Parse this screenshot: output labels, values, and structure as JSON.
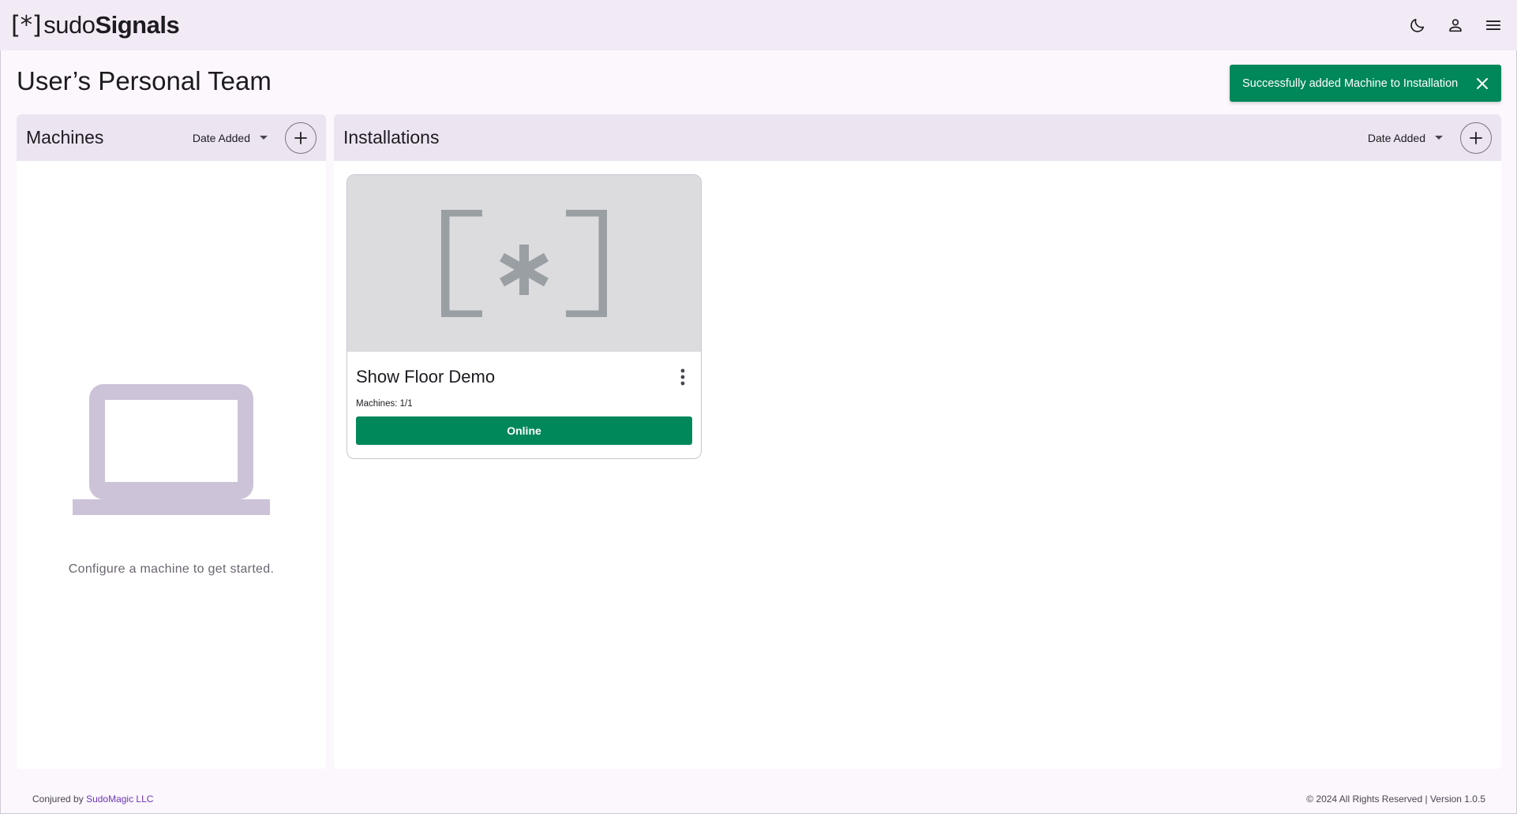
{
  "app": {
    "logo_bracket_open": "[",
    "logo_star": "*",
    "logo_bracket_close": "]",
    "logo_light": "sudo",
    "logo_bold": "Signals"
  },
  "topbar": {
    "icons": [
      "moon-icon",
      "account-icon",
      "menu-icon"
    ]
  },
  "page": {
    "title": "User’s Personal Team"
  },
  "toast": {
    "message": "Successfully added Machine to Installation",
    "color": "#00875a"
  },
  "machines": {
    "title": "Machines",
    "sort_label": "Date Added",
    "empty_message": "Configure a machine to get started."
  },
  "installations": {
    "title": "Installations",
    "sort_label": "Date Added",
    "items": [
      {
        "name": "Show Floor Demo",
        "machines_label": "Machines: 1/1",
        "status": "Online",
        "status_color": "#00875a"
      }
    ]
  },
  "footer": {
    "conjured_prefix": "Conjured by",
    "company": "SudoMagic LLC",
    "copyright": "© 2024 All Rights Reserved | Version 1.0.5"
  },
  "colors": {
    "topbar_bg": "#f2ebf6",
    "page_bg": "#fcf7fd",
    "panel_header_bg": "#ece4f0",
    "accent_green": "#00875a",
    "link_purple": "#6b35b8",
    "empty_icon": "#cdc3d8"
  }
}
